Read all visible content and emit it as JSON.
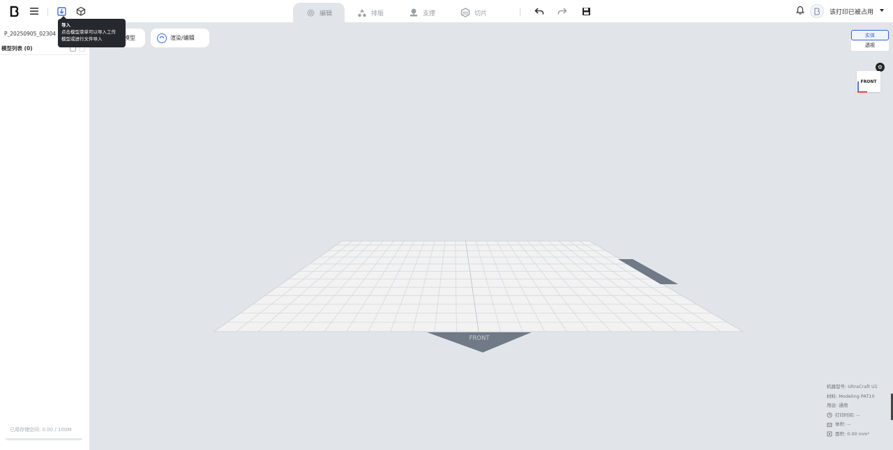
{
  "toolbar": {
    "logo_icon": "brand-logo-icon",
    "menu_icon": "hamburger-menu-icon",
    "import_icon": "import-file-icon",
    "model_icon": "cube-icon",
    "undo_icon": "undo-icon",
    "redo_icon": "redo-icon",
    "save_icon": "save-icon",
    "notify_icon": "bell-icon"
  },
  "tabs": [
    {
      "label": "编辑",
      "icon": "gear-icon",
      "active": true
    },
    {
      "label": "排版",
      "icon": "layout-icon",
      "active": false
    },
    {
      "label": "支撑",
      "icon": "support-icon",
      "active": false
    },
    {
      "label": "切片",
      "icon": "slice-icon",
      "active": false
    }
  ],
  "user": {
    "avatar_text": "",
    "name": "该打印已被占用"
  },
  "left_panel": {
    "project_name": "P_20250905_02304",
    "list_title": "模型列表 (0)",
    "storage_text": "已用存储空间: 0.00 / 100M",
    "storage_fraction": 0.0
  },
  "tooltip": {
    "title": "导入",
    "line1": "点击模型菜单可以导入工作",
    "line2": "模型或进行文件导入"
  },
  "canvas_buttons": [
    {
      "label": "模型",
      "icon": "model-icon"
    },
    {
      "label": "渲染/编辑",
      "icon": "render-icon"
    }
  ],
  "view_toggle": {
    "option_a": "实体",
    "option_b": "透视",
    "selected": "实体"
  },
  "navcube": {
    "face_label": "FRONT",
    "settings_icon": "settings-dot-icon"
  },
  "plate": {
    "front_label": "FRONT"
  },
  "info": {
    "machine": "机器型号: UltraCraft U1",
    "material": "材料: Modeling PAT10",
    "purpose": "用途: 通用",
    "time": "打印时间: --",
    "volume": "体积: --",
    "area": "面积: 0.00 mm²"
  },
  "colors": {
    "background": "#e1e5ea",
    "panel": "#ffffff",
    "accent": "#2c63d8",
    "plate_marker": "#6f7a86"
  }
}
